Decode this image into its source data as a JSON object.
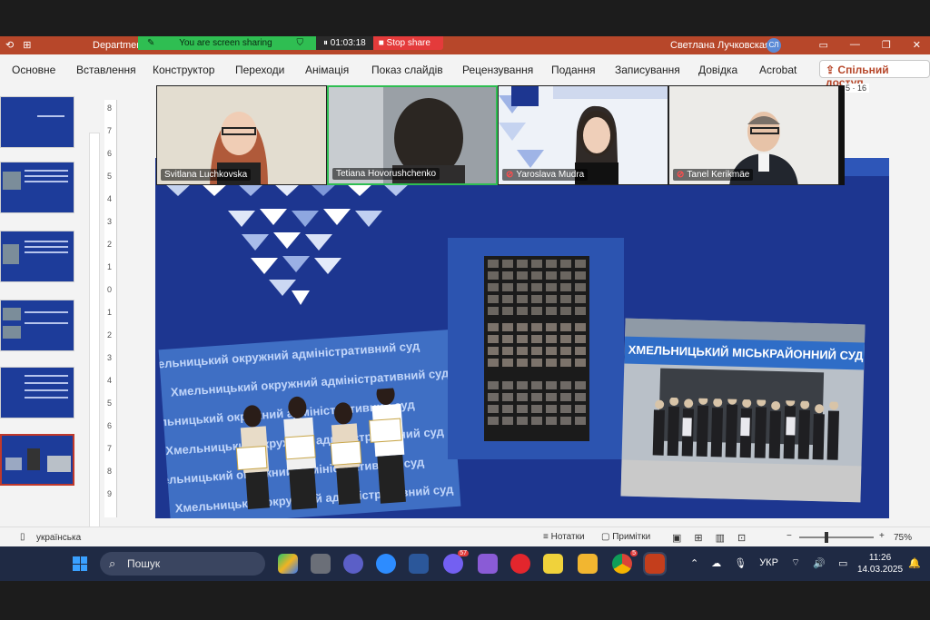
{
  "titlebar": {
    "doc_name": "Departmen",
    "sharing_text": "You are screen sharing",
    "timer": "01:03:18",
    "stop_share": "Stop share",
    "user_name": "Светлана Лучковская",
    "user_initials": "СЛ",
    "accent": "#b7472a"
  },
  "ribbon": {
    "tabs": [
      "Основне",
      "Вставлення",
      "Конструктор",
      "Переходи",
      "Анімація",
      "Показ слайдів",
      "Рецензування",
      "Подання",
      "Записування",
      "Довідка",
      "Acrobat"
    ],
    "share_button": "Спільний доступ"
  },
  "ruler": [
    "8",
    "7",
    "6",
    "5",
    "4",
    "3",
    "2",
    "1",
    "0",
    "1",
    "2",
    "3",
    "4",
    "5",
    "6",
    "7",
    "8",
    "9"
  ],
  "page_indicator": "5 · 16",
  "participants": [
    {
      "name": "Svitlana Luchkovska",
      "muted": false
    },
    {
      "name": "Tetiana Hovorushchenko",
      "muted": false
    },
    {
      "name": "Yaroslava Mudra",
      "muted": true
    },
    {
      "name": "Tanel Kerikmäe",
      "muted": true
    }
  ],
  "slide": {
    "watermark_text": "Хмельницький окружний адміністративний суд",
    "court_sign": "ХМЕЛЬНИЦЬКИЙ МІСЬКРАЙОННИЙ СУД",
    "background": "#1d3690"
  },
  "statusbar": {
    "language": "українська",
    "notes": "Нотатки",
    "comments": "Примітки",
    "zoom": "75%"
  },
  "taskbar": {
    "search_placeholder": "Пошук",
    "lang": "УКР",
    "time": "11:26",
    "date": "14.03.2025",
    "viber_badge": "57",
    "chrome_badge": "5"
  }
}
